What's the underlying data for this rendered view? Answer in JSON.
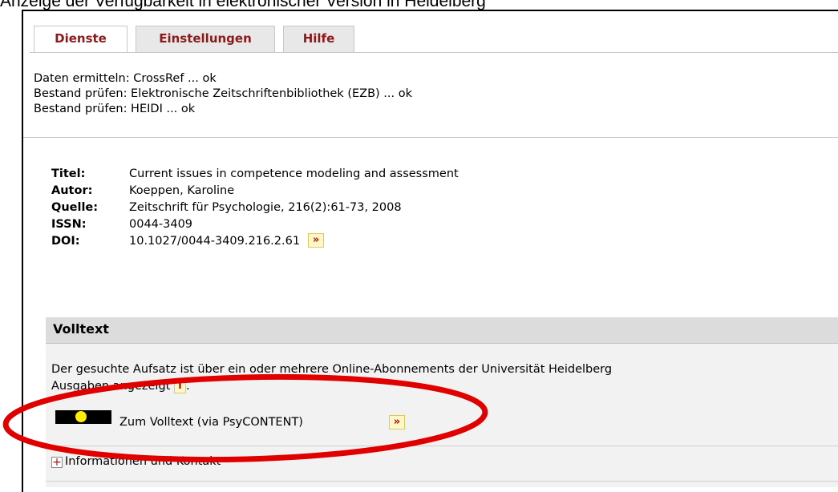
{
  "caption": "Anzeige der Verfügbarkeit in elektronischer  Version in Heidelberg",
  "tabs": [
    {
      "label": "Dienste",
      "active": true
    },
    {
      "label": "Einstellungen",
      "active": false
    },
    {
      "label": "Hilfe",
      "active": false
    }
  ],
  "status_lines": [
    "Daten ermitteln: CrossRef ... ok",
    "Bestand prüfen: Elektronische Zeitschriftenbibliothek (EZB) ... ok",
    "Bestand prüfen: HEIDI ... ok"
  ],
  "metadata": {
    "title_label": "Titel:",
    "title_value": "Current issues in competence modeling and assessment",
    "author_label": "Autor:",
    "author_value": "Koeppen, Karoline",
    "source_label": "Quelle:",
    "source_value": "Zeitschrift für Psychologie, 216(2):61-73, 2008",
    "issn_label": "ISSN:",
    "issn_value": "0044-3409",
    "doi_label": "DOI:",
    "doi_value": "10.1027/0044-3409.216.2.61",
    "doi_link_glyph": "»"
  },
  "volltext": {
    "heading": "Volltext",
    "line1": "Der gesuchte Aufsatz ist über ein oder mehrere Online-Abonnements der Universität Heidelberg",
    "line2": "Ausgaben angezeigt",
    "info_glyph": "i",
    "line2_end": ".",
    "signal_color": "#ffee00",
    "fulltext_label": "Zum Volltext (via PsyCONTENT)",
    "fulltext_glyph": "»",
    "expander_glyph": "+",
    "expander_label": "Informationen und Kontakt"
  },
  "colors": {
    "tab_text": "#8b1a1a",
    "highlight_ellipse": "#e00000",
    "button_bg": "#fff7c4"
  }
}
